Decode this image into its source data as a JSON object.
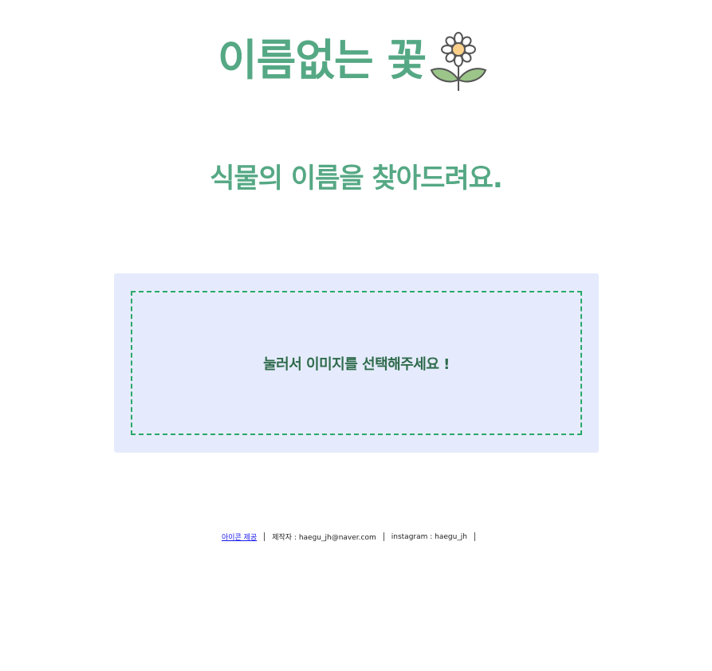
{
  "header": {
    "logo_text": "이름없는 꽃",
    "logo_icon": "daisy-flower-icon"
  },
  "main": {
    "subtitle": "식물의 이름을 찾아드려요.",
    "upload_label": "눌러서 이미지를 선택해주세요 !"
  },
  "footer": {
    "icon_credit_link": "아이콘 제공",
    "maker": "제작자 : haegu_jh@naver.com",
    "instagram": "instagram : haegu_jh"
  },
  "colors": {
    "brand_green": "#55a884",
    "upload_bg": "#e5ebfc",
    "dashed_border": "#2aa86a",
    "upload_text": "#2f6b4c"
  }
}
